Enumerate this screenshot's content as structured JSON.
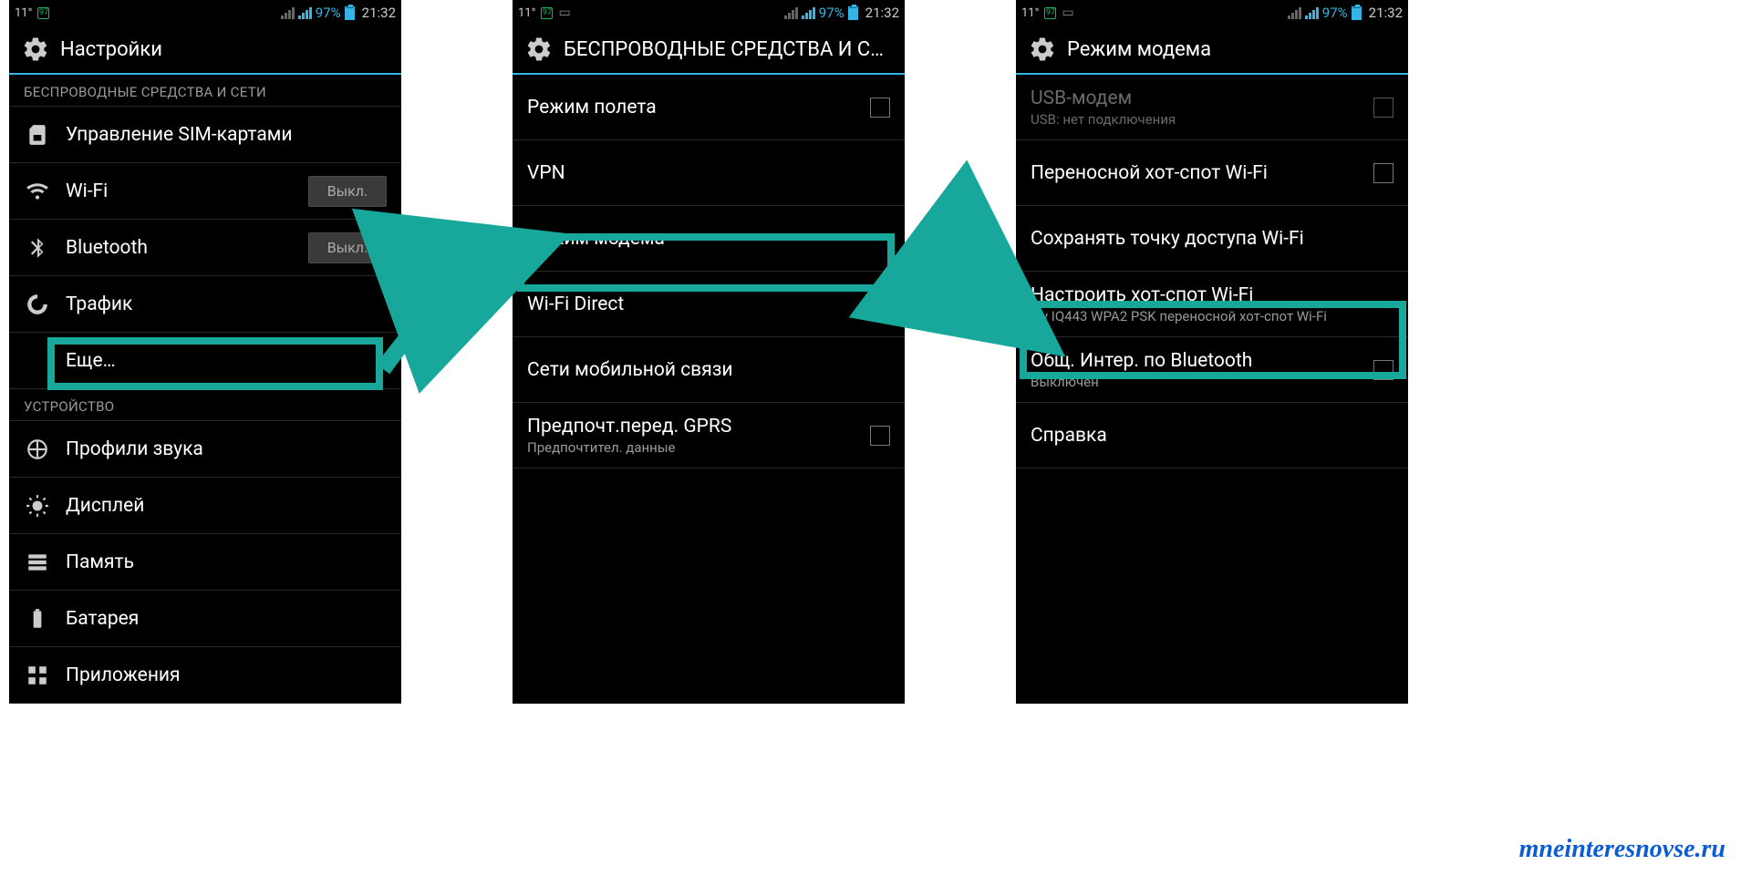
{
  "statusbar": {
    "temp": "11°",
    "icon_box": "97",
    "battery_pct": "97%",
    "time": "21:32"
  },
  "phone1": {
    "title": "Настройки",
    "section1": "БЕСПРОВОДНЫЕ СРЕДСТВА И СЕТИ",
    "sim": "Управление SIM-картами",
    "wifi": "Wi-Fi",
    "wifi_toggle": "Выкл.",
    "bt": "Bluetooth",
    "bt_toggle": "Выкл.",
    "traffic": "Трафик",
    "more": "Еще…",
    "section2": "УСТРОЙСТВО",
    "sound": "Профили звука",
    "display": "Дисплей",
    "memory": "Память",
    "battery": "Батарея",
    "apps": "Приложения"
  },
  "phone2": {
    "title": "БЕСПРОВОДНЫЕ СРЕДСТВА И СЕ…",
    "airplane": "Режим полета",
    "vpn": "VPN",
    "tether": "Режим модема",
    "wfd": "Wi-Fi Direct",
    "mobile": "Сети мобильной связи",
    "gprs": "Предпочт.перед. GPRS",
    "gprs_sub": "Предпочтител. данные"
  },
  "phone3": {
    "title": "Режим модема",
    "usb": "USB-модем",
    "usb_sub": "USB: нет подключения",
    "hotspot": "Переносной хот-спот Wi-Fi",
    "keep": "Сохранять точку доступа Wi-Fi",
    "configure": "Настроить хот-спот Wi-Fi",
    "configure_sub": "Fly IQ443 WPA2 PSK переносной хот-спот Wi-Fi",
    "bt_share": "Общ. Интер. по Bluetooth",
    "bt_share_sub": "Выключен",
    "help": "Справка"
  },
  "watermark": "mneinteresnovse.ru"
}
